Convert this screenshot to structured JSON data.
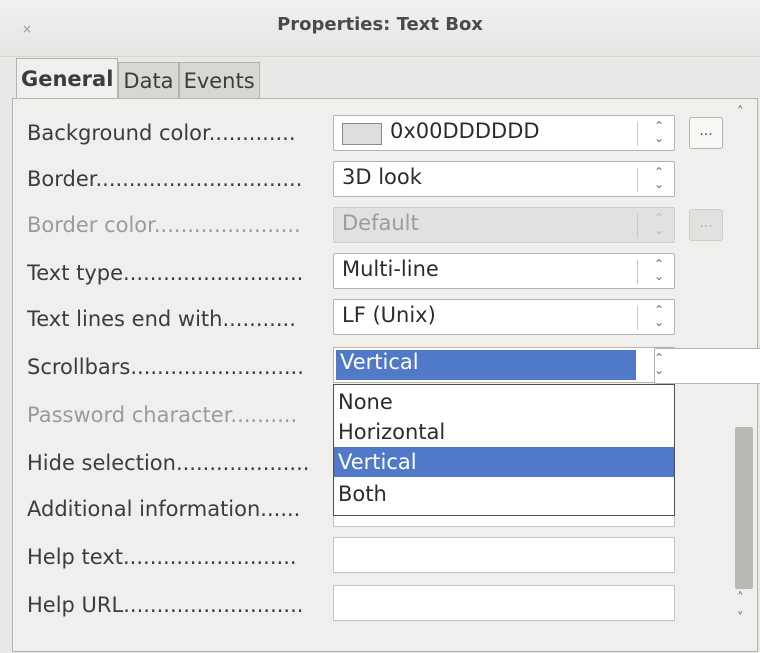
{
  "window": {
    "title": "Properties: Text Box",
    "close_glyph": "×"
  },
  "tabs": [
    {
      "label": "General",
      "active": true
    },
    {
      "label": "Data",
      "active": false
    },
    {
      "label": "Events",
      "active": false
    }
  ],
  "properties": {
    "background_color": {
      "label": "Background color.............",
      "value": "0x00DDDDDD",
      "swatch": "#dddddd",
      "button": "..."
    },
    "border": {
      "label": "Border...............................",
      "value": "3D look"
    },
    "border_color": {
      "label": "Border color......................",
      "value": "Default",
      "button": "..."
    },
    "text_type": {
      "label": "Text type...........................",
      "value": "Multi-line"
    },
    "text_lines_end": {
      "label": "Text lines end with...........",
      "value": "LF (Unix)"
    },
    "scrollbars": {
      "label": "Scrollbars..........................",
      "value": "Vertical"
    },
    "password_character": {
      "label": "Password character.........."
    },
    "hide_selection": {
      "label": "Hide selection...................."
    },
    "additional_information": {
      "label": "Additional information......"
    },
    "help_text": {
      "label": "Help text..........................",
      "value": ""
    },
    "help_url": {
      "label": "Help URL...........................",
      "value": ""
    }
  },
  "scrollbars_dropdown": {
    "options": [
      "None",
      "Horizontal",
      "Vertical",
      "Both"
    ],
    "selected": "Vertical"
  },
  "icons": {
    "spin": "⌃⌄",
    "scroll_up": "˄",
    "scroll_down": "˅"
  },
  "colors": {
    "selection": "#5079c8"
  }
}
